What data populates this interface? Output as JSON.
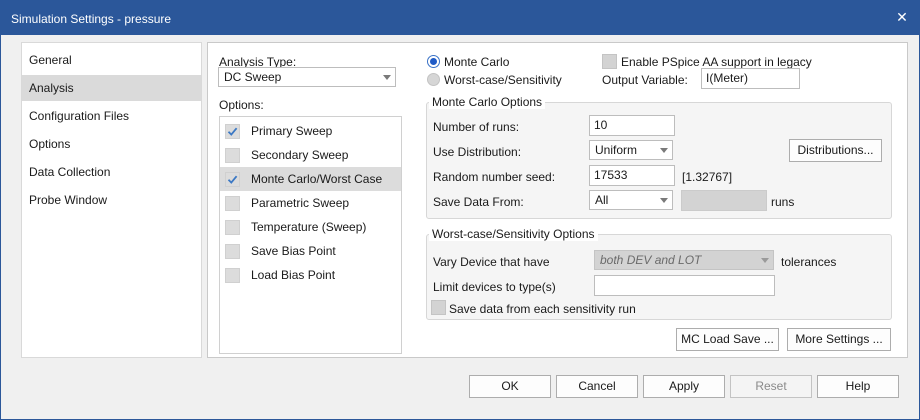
{
  "window": {
    "title": "Simulation Settings - pressure",
    "close_glyph": "✕"
  },
  "categories": [
    {
      "label": "General",
      "selected": false
    },
    {
      "label": "Analysis",
      "selected": true
    },
    {
      "label": "Configuration Files",
      "selected": false
    },
    {
      "label": "Options",
      "selected": false
    },
    {
      "label": "Data Collection",
      "selected": false
    },
    {
      "label": "Probe Window",
      "selected": false
    }
  ],
  "analysis": {
    "type_label": "Analysis Type:",
    "type_value": "DC Sweep",
    "options_label": "Options:",
    "options": [
      {
        "label": "Primary Sweep",
        "checked": true,
        "selected": false
      },
      {
        "label": "Secondary Sweep",
        "checked": false,
        "selected": false
      },
      {
        "label": "Monte Carlo/Worst Case",
        "checked": true,
        "selected": true
      },
      {
        "label": "Parametric Sweep",
        "checked": false,
        "selected": false
      },
      {
        "label": "Temperature (Sweep)",
        "checked": false,
        "selected": false
      },
      {
        "label": "Save Bias Point",
        "checked": false,
        "selected": false
      },
      {
        "label": "Load Bias Point",
        "checked": false,
        "selected": false
      }
    ]
  },
  "mode": {
    "monte_carlo": "Monte Carlo",
    "worst_case": "Worst-case/Sensitivity",
    "selected": "monte_carlo",
    "pspice_aa_label": "Enable PSpice AA support in legacy",
    "output_variable_label": "Output Variable:",
    "output_variable_value": "I(Meter)"
  },
  "monte_carlo_options": {
    "title": "Monte Carlo Options",
    "runs_label": "Number of runs:",
    "runs_value": "10",
    "distribution_label": "Use Distribution:",
    "distribution_value": "Uniform",
    "distributions_button": "Distributions...",
    "seed_label": "Random number seed:",
    "seed_value": "17533",
    "seed_range": "[1.32767]",
    "save_label": "Save Data From:",
    "save_value": "All",
    "runs_suffix": "runs"
  },
  "worst_case_options": {
    "title": "Worst-case/Sensitivity Options",
    "vary_label": "Vary Device that have",
    "vary_value": "both DEV and LOT",
    "tolerances_label": "tolerances",
    "limit_label": "Limit devices to type(s)",
    "limit_value": "",
    "save_each_label": "Save data from each sensitivity run"
  },
  "panel_buttons": {
    "mc_load_save": "MC Load Save ...",
    "more_settings": "More Settings ..."
  },
  "dialog_buttons": {
    "ok": "OK",
    "cancel": "Cancel",
    "apply": "Apply",
    "reset": "Reset",
    "help": "Help"
  },
  "colors": {
    "title_bar": "#2b579a",
    "radio_selected": "#1f5bc6",
    "check_mark": "#3b78c4"
  }
}
